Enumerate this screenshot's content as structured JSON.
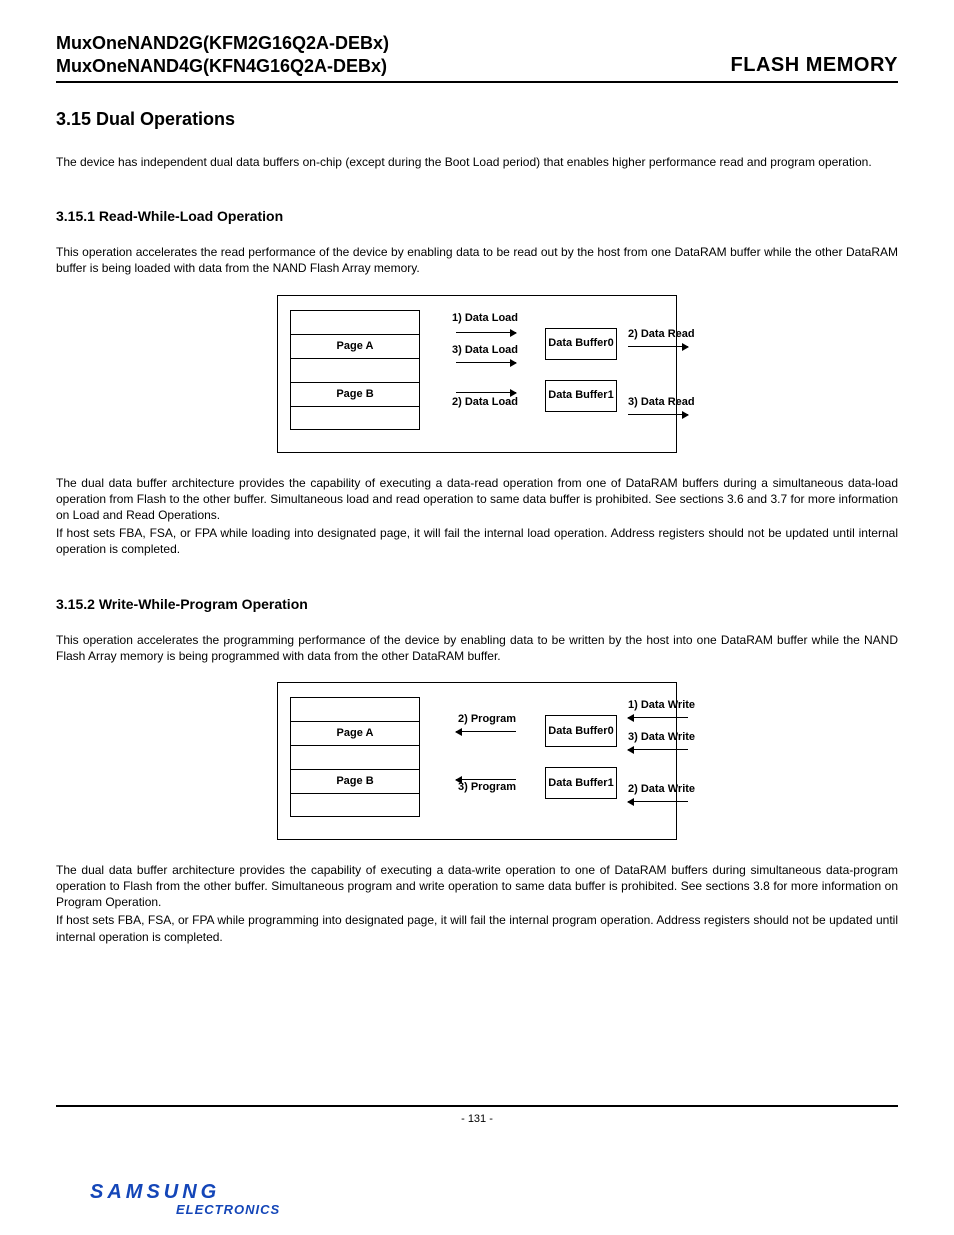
{
  "header": {
    "line1": "MuxOneNAND2G(KFM2G16Q2A-DEBx)",
    "line2": "MuxOneNAND4G(KFN4G16Q2A-DEBx)",
    "right": "FLASH MEMORY"
  },
  "section": {
    "title": "3.15  Dual Operations",
    "intro": "The device has independent dual data buffers on-chip (except during the Boot Load period) that enables higher  performance read and program operation."
  },
  "sub1": {
    "title": "3.15.1 Read-While-Load Operation",
    "p1": "This operation accelerates the read performance of the device by enabling data to be read out by the host from one DataRAM buffer while the other DataRAM buffer is being loaded with data from the NAND Flash Array memory.",
    "p2": "The dual data buffer architecture provides the capability of executing a data-read operation from one of DataRAM buffers during a simultaneous data-load operation from Flash to the other buffer. Simultaneous load and read operation to same data buffer is prohibited. See sections 3.6 and 3.7 for more information on Load and Read Operations.",
    "p3": "If host sets FBA, FSA, or FPA while loading into designated page, it will fail the internal load operation. Address registers should not be updated until internal operation is completed."
  },
  "diag1": {
    "pageA": "Page A",
    "pageB": "Page B",
    "buf0": "Data Buffer0",
    "buf1": "Data Buffer1",
    "l1": "1) Data Load",
    "l2": "2) Data Load",
    "l3": "3) Data Load",
    "r2": "2) Data Read",
    "r3": "3) Data Read"
  },
  "sub2": {
    "title": "3.15.2 Write-While-Program Operation",
    "p1": "This operation accelerates the programming performance of the device by enabling data to be written by the host into one DataRAM buffer while the NAND Flash Array memory is being programmed with data from the other DataRAM buffer.",
    "p2": "The dual data buffer architecture provides the capability of executing a data-write operation to one of DataRAM buffers during simultaneous data-program operation to Flash from the other buffer. Simultaneous program and write operation to same data buffer is   prohibited. See sections 3.8 for more information on Program Operation.",
    "p3": "If host sets FBA, FSA, or FPA while programming into designated page,  it will fail the internal program operation. Address registers should not be updated until internal operation is completed."
  },
  "diag2": {
    "pageA": "Page A",
    "pageB": "Page B",
    "buf0": "Data Buffer0",
    "buf1": "Data Buffer1",
    "p2": "2) Program",
    "p3": "3) Program",
    "w1": "1) Data Write",
    "w2": "2) Data Write",
    "w3": "3) Data Write"
  },
  "footer": {
    "pagenum": "- 131 -",
    "logo_main": "SAMSUNG",
    "logo_sub": "ELECTRONICS"
  }
}
